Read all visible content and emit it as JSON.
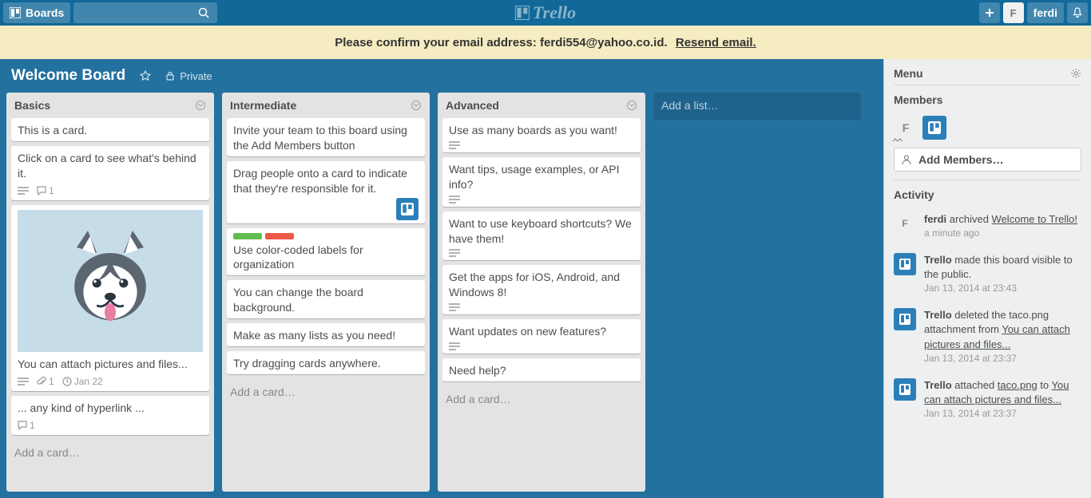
{
  "header": {
    "boards_label": "Boards",
    "logo_text": "Trello",
    "username": "ferdi",
    "avatar_initial": "F"
  },
  "banner": {
    "text_prefix": "Please confirm your email address: ",
    "email": "ferdi554@yahoo.co.id.",
    "resend_label": "Resend email."
  },
  "board": {
    "title": "Welcome Board",
    "privacy_label": "Private",
    "add_list_label": "Add a list…",
    "add_card_label": "Add a card…"
  },
  "lists": [
    {
      "title": "Basics",
      "cards": [
        {
          "text": "This is a card."
        },
        {
          "text": "Click on a card to see what's behind it.",
          "desc": true,
          "comments": "1"
        },
        {
          "text": "You can attach pictures and files...",
          "cover": true,
          "desc": true,
          "attach": "1",
          "due": "Jan 22"
        },
        {
          "text": "... any kind of hyperlink ...",
          "comments": "1"
        }
      ]
    },
    {
      "title": "Intermediate",
      "cards": [
        {
          "text": "Invite your team to this board using the Add Members button"
        },
        {
          "text": "Drag people onto a card to indicate that they're responsible for it.",
          "member": true
        },
        {
          "text": "Use color-coded labels for organization",
          "labels": [
            "#61BD4F",
            "#EB5A46"
          ]
        },
        {
          "text": "You can change the board background."
        },
        {
          "text": "Make as many lists as you need!"
        },
        {
          "text": "Try dragging cards anywhere."
        }
      ]
    },
    {
      "title": "Advanced",
      "cards": [
        {
          "text": "Use as many boards as you want!",
          "desc": true
        },
        {
          "text": "Want tips, usage examples, or API info?",
          "desc": true
        },
        {
          "text": "Want to use keyboard shortcuts? We have them!",
          "desc": true
        },
        {
          "text": "Get the apps for iOS, Android, and Windows 8!",
          "desc": true
        },
        {
          "text": "Want updates on new features?",
          "desc": true
        },
        {
          "text": "Need help?"
        }
      ]
    }
  ],
  "sidebar": {
    "menu_title": "Menu",
    "members_title": "Members",
    "add_members_label": "Add Members…",
    "activity_title": "Activity",
    "activity": [
      {
        "avatar_type": "user",
        "initial": "F",
        "actor": "ferdi",
        "html_before": " archived ",
        "link1": "Welcome to Trello!",
        "time": "a minute ago"
      },
      {
        "avatar_type": "trello",
        "actor": "Trello",
        "html_before": " made this board visible to the public.",
        "time": "Jan 13, 2014 at 23:43"
      },
      {
        "avatar_type": "trello",
        "actor": "Trello",
        "html_before": " deleted the taco.png attachment from ",
        "link1": "You can attach pictures and files...",
        "time": "Jan 13, 2014 at 23:37"
      },
      {
        "avatar_type": "trello",
        "actor": "Trello",
        "html_before": " attached ",
        "link1": "taco.png",
        "html_mid": " to ",
        "link2": "You can attach pictures and files...",
        "time": "Jan 13, 2014 at 23:37"
      }
    ]
  }
}
